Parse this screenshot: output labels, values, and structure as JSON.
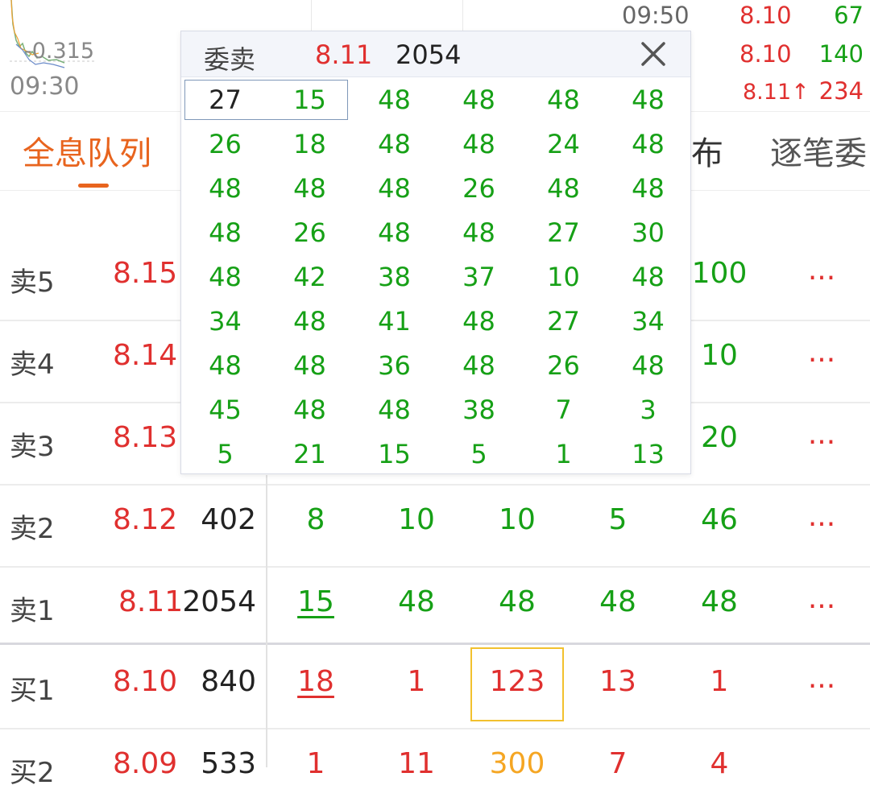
{
  "top_chart": {
    "baseline_label": "-0.315",
    "time_start": "09:30",
    "ticks": [
      {
        "time": "09:50",
        "price": "8.10",
        "volume": "67",
        "price_color": "#e0302f",
        "volume_color": "#16a016"
      },
      {
        "time": "",
        "price": "8.10",
        "volume": "140",
        "price_color": "#e0302f",
        "volume_color": "#16a016"
      },
      {
        "time": "",
        "price": "8.11↑",
        "volume": "234",
        "price_color": "#e0302f",
        "volume_color": "#e0302f"
      }
    ]
  },
  "tabs": [
    {
      "label": "全息队列",
      "active": true
    },
    {
      "label": "布",
      "active": false
    },
    {
      "label": "逐笔委",
      "active": false
    }
  ],
  "order_book": {
    "rows": [
      {
        "level": "卖5",
        "price": "8.15",
        "volume": "",
        "queue": [
          "",
          "",
          "",
          "",
          "100"
        ],
        "more": "..."
      },
      {
        "level": "卖4",
        "price": "8.14",
        "volume": "",
        "queue": [
          "",
          "",
          "",
          "",
          "10"
        ],
        "more": "..."
      },
      {
        "level": "卖3",
        "price": "8.13",
        "volume": "",
        "queue": [
          "",
          "",
          "",
          "",
          "20"
        ],
        "more": "..."
      },
      {
        "level": "卖2",
        "price": "8.12",
        "volume": "402",
        "queue": [
          "8",
          "10",
          "10",
          "5",
          "46"
        ],
        "more": "..."
      },
      {
        "level": "卖1",
        "price": "8.11",
        "volume": "2054",
        "queue": [
          "15",
          "48",
          "48",
          "48",
          "48"
        ],
        "more": "..."
      },
      {
        "level": "买1",
        "price": "8.10",
        "volume": "840",
        "queue": [
          "18",
          "1",
          "123",
          "13",
          "1"
        ],
        "more": "..."
      },
      {
        "level": "买2",
        "price": "8.09",
        "volume": "533",
        "queue": [
          "1",
          "11",
          "300",
          "7",
          "4"
        ],
        "more": "..."
      }
    ]
  },
  "popup": {
    "label": "委卖",
    "price": "8.11",
    "volume": "2054",
    "close_icon": "close-icon",
    "cells": [
      "27",
      "15",
      "48",
      "48",
      "48",
      "48",
      "26",
      "18",
      "48",
      "48",
      "24",
      "48",
      "48",
      "48",
      "48",
      "26",
      "48",
      "48",
      "48",
      "26",
      "48",
      "48",
      "27",
      "30",
      "48",
      "42",
      "38",
      "37",
      "10",
      "48",
      "34",
      "48",
      "41",
      "48",
      "27",
      "34",
      "48",
      "48",
      "36",
      "48",
      "26",
      "48",
      "45",
      "48",
      "48",
      "38",
      "7",
      "3",
      "5",
      "21",
      "15",
      "5",
      "1",
      "13"
    ]
  },
  "colors": {
    "accent": "#e8641e",
    "up": "#e0302f",
    "down": "#16a016",
    "highlight": "#f2c12e"
  }
}
